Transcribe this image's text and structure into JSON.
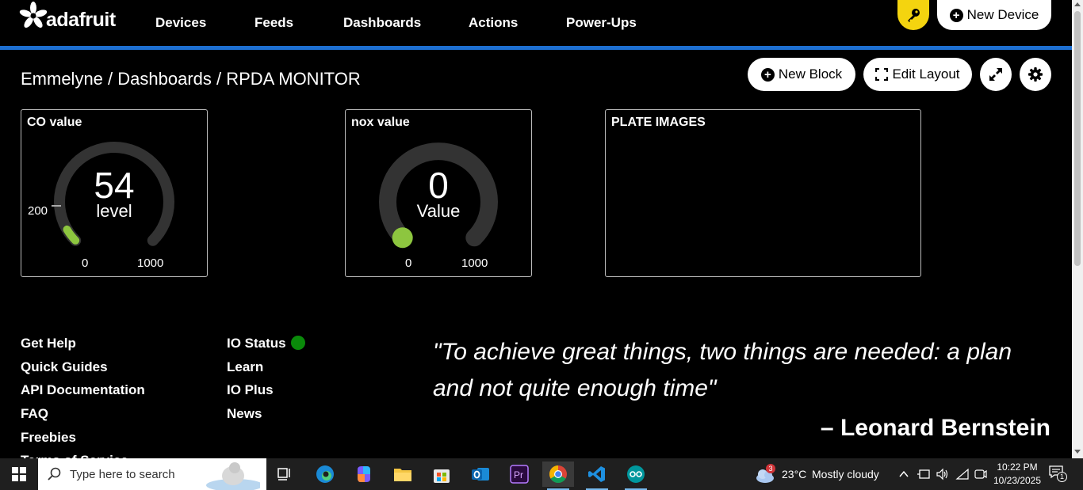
{
  "brand": {
    "name": "adafruit"
  },
  "nav": {
    "items": [
      "Devices",
      "Feeds",
      "Dashboards",
      "Actions",
      "Power-Ups"
    ],
    "new_device": "New Device",
    "key_icon": "key-icon"
  },
  "breadcrumb": "Emmelyne / Dashboards / RPDA MONITOR",
  "toolbar": {
    "new_block": "New Block",
    "edit_layout": "Edit Layout",
    "fullscreen_icon": "expand-icon",
    "settings_icon": "gear-icon"
  },
  "blocks": {
    "co": {
      "title": "CO value",
      "value": "54",
      "label": "level",
      "min": "0",
      "max": "1000",
      "marker": "200",
      "level": 0.054
    },
    "nox": {
      "title": "nox value",
      "value": "0",
      "label": "Value",
      "min": "0",
      "max": "1000",
      "level": 0
    },
    "plate": {
      "title": "PLATE IMAGES"
    }
  },
  "footer": {
    "col1": [
      "Get Help",
      "Quick Guides",
      "API Documentation",
      "FAQ",
      "Freebies",
      "Terms of Service"
    ],
    "col2": [
      "IO Status",
      "Learn",
      "IO Plus",
      "News"
    ],
    "quote": "\"To achieve great things, two things are needed: a plan and not quite enough time\"",
    "author": "– Leonard Bernstein"
  },
  "taskbar": {
    "search_placeholder": "Type here to search",
    "weather_badge": "3",
    "weather_temp": "23°C",
    "weather_desc": "Mostly cloudy",
    "time": "10:22 PM",
    "date": "10/23/2025",
    "notification_count": "1"
  },
  "colors": {
    "accent_blue": "#1d6fd1",
    "key_yellow": "#f4d40f",
    "gauge_green": "#8dc63f",
    "status_green": "#0a8a0a"
  }
}
